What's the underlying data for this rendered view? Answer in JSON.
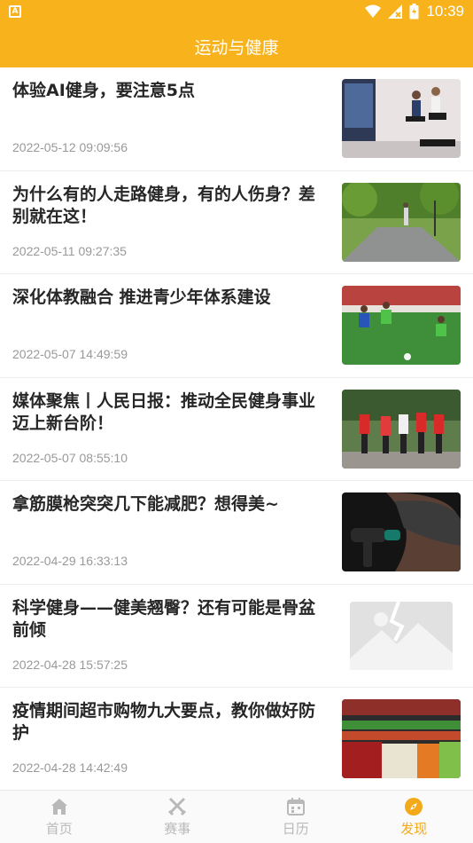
{
  "status_bar": {
    "time": "10:39",
    "notification_icon_letter": "A"
  },
  "header": {
    "title": "运动与健康"
  },
  "articles": [
    {
      "title": "体验AI健身，要注意5点",
      "date": "2022-05-12 09:09:56",
      "thumbnail": "fitness-training-photo"
    },
    {
      "title": "为什么有的人走路健身，有的人伤身？差别就在这！",
      "date": "2022-05-11 09:27:35",
      "thumbnail": "park-walking-photo"
    },
    {
      "title": "深化体教融合 推进青少年体系建设",
      "date": "2022-05-07 14:49:59",
      "thumbnail": "youth-soccer-photo"
    },
    {
      "title": "媒体聚焦丨人民日报：推动全民健身事业迈上新台阶！",
      "date": "2022-05-07 08:55:10",
      "thumbnail": "group-running-photo"
    },
    {
      "title": "拿筋膜枪突突几下能减肥？想得美~",
      "date": "2022-04-29 16:33:13",
      "thumbnail": "massage-gun-photo"
    },
    {
      "title": "科学健身——健美翘臀？还有可能是骨盆前倾",
      "date": "2022-04-28 15:57:25",
      "thumbnail": "image-placeholder"
    },
    {
      "title": "疫情期间超市购物九大要点，教你做好防护",
      "date": "2022-04-28 14:42:49",
      "thumbnail": "supermarket-produce-photo"
    }
  ],
  "tab_bar": {
    "tabs": [
      {
        "label": "首页",
        "icon": "home-icon",
        "active": false
      },
      {
        "label": "赛事",
        "icon": "crossed-swords-icon",
        "active": false
      },
      {
        "label": "日历",
        "icon": "calendar-icon",
        "active": false
      },
      {
        "label": "发现",
        "icon": "compass-icon",
        "active": true
      }
    ]
  },
  "colors": {
    "accent": "#f8b31c",
    "active_tab": "#f2a91a",
    "inactive_tab": "#b9b9b9",
    "title_text": "#262626",
    "date_text": "#999999"
  }
}
